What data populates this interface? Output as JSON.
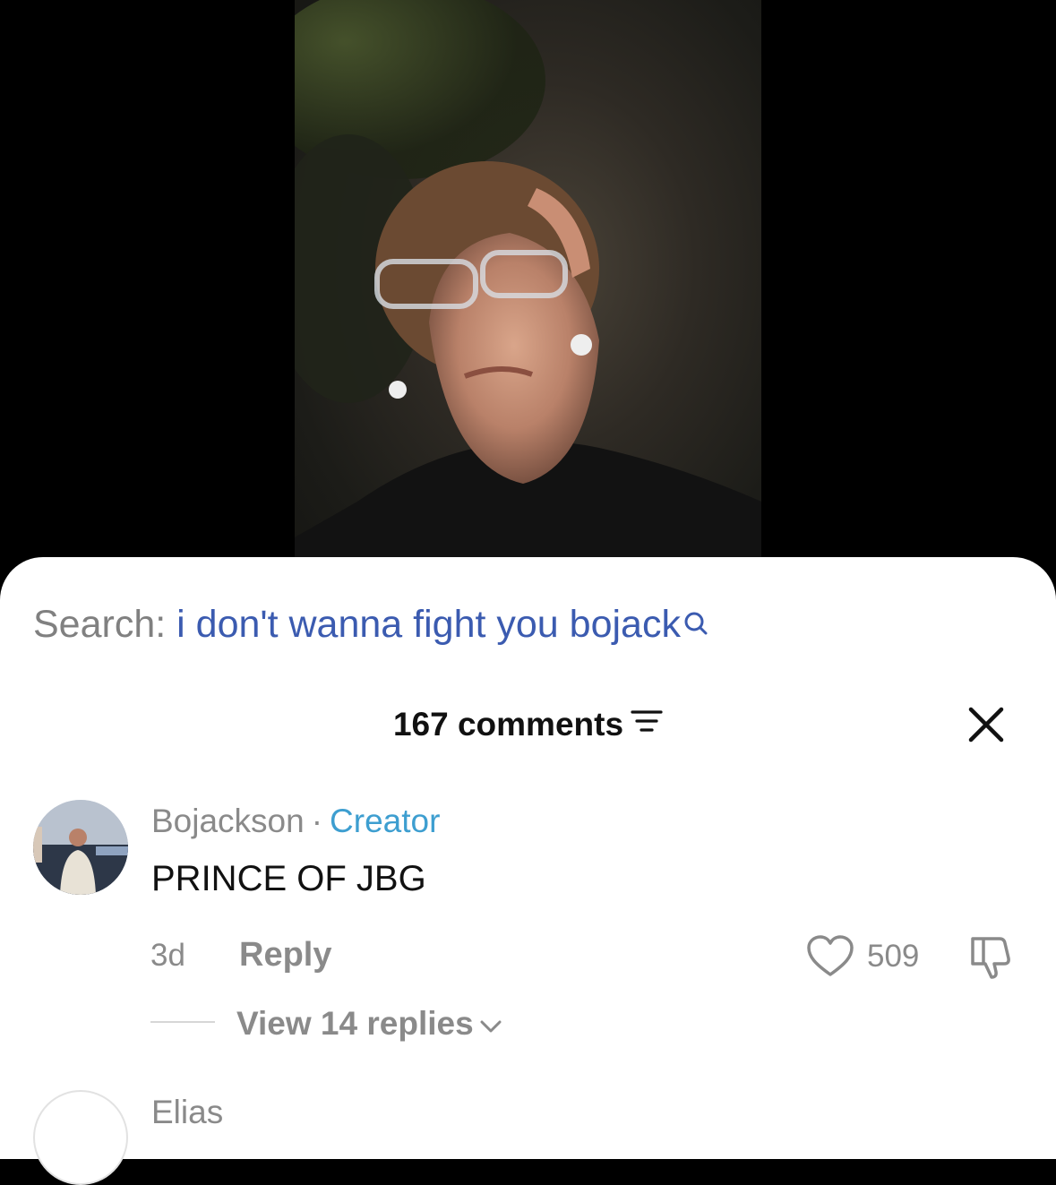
{
  "search": {
    "label": "Search:",
    "query": "i don't wanna fight you bojack"
  },
  "comments_header": {
    "count_label": "167 comments"
  },
  "comments": [
    {
      "author": "Bojackson",
      "separator": "·",
      "tag": "Creator",
      "text": "PRINCE OF JBG",
      "time": "3d",
      "reply_label": "Reply",
      "likes": "509",
      "view_replies_label": "View 14 replies"
    },
    {
      "author": "Elias",
      "text": ""
    }
  ],
  "colors": {
    "search_query": "#3b5bb0",
    "creator_tag": "#3d9ed0",
    "muted_text": "#8a8a8a"
  },
  "icons": [
    "search-icon",
    "filter-icon",
    "close-icon",
    "heart-icon",
    "dislike-icon",
    "chevron-down-icon"
  ]
}
